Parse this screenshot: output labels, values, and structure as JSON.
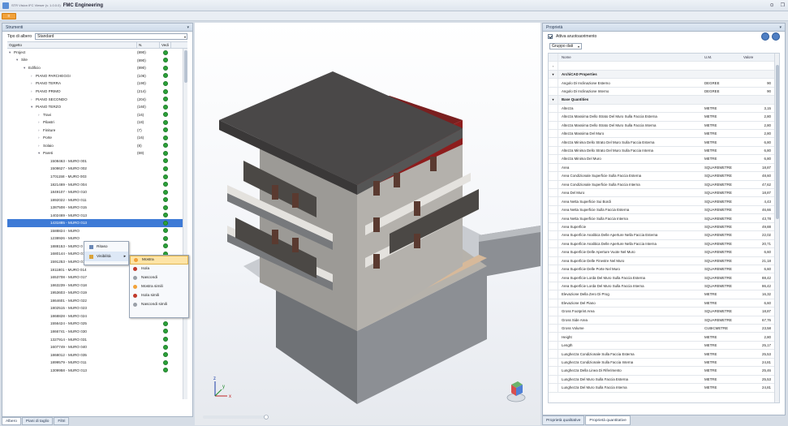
{
  "window": {
    "title_prefix": "STR Vision IFC Viewer (v. 1.0.0.0)",
    "title": "FMC Engineering",
    "controls": [
      "⊙",
      "❐"
    ],
    "menu_label": "≡"
  },
  "left_panel": {
    "header": "Strumenti",
    "tree_type_label": "Tipo di albero",
    "tree_type_value": "Standard",
    "columns": [
      "Oggetto",
      "N.",
      "Vedi"
    ],
    "rows": [
      {
        "indent": 0,
        "arrow": "▾",
        "name": "Project",
        "count": "(890)"
      },
      {
        "indent": 1,
        "arrow": "▾",
        "name": "Site",
        "count": "(890)"
      },
      {
        "indent": 2,
        "arrow": "▾",
        "name": "Edificio",
        "count": "(890)"
      },
      {
        "indent": 3,
        "arrow": "›",
        "name": "PIANO PARCHEGGI",
        "count": "(106)"
      },
      {
        "indent": 3,
        "arrow": "›",
        "name": "PIANO TERRA",
        "count": "(190)"
      },
      {
        "indent": 3,
        "arrow": "›",
        "name": "PIANO PRIMO",
        "count": "(214)"
      },
      {
        "indent": 3,
        "arrow": "›",
        "name": "PIANO SECONDO",
        "count": "(204)"
      },
      {
        "indent": 3,
        "arrow": "▾",
        "name": "PIANO TERZO",
        "count": "(160)"
      },
      {
        "indent": 4,
        "arrow": "›",
        "name": "Travi",
        "count": "(16)"
      },
      {
        "indent": 4,
        "arrow": "›",
        "name": "Pilastri",
        "count": "(18)"
      },
      {
        "indent": 4,
        "arrow": "›",
        "name": "Finiture",
        "count": "(7)"
      },
      {
        "indent": 4,
        "arrow": "›",
        "name": "Porte",
        "count": "(16)"
      },
      {
        "indent": 4,
        "arrow": "›",
        "name": "Solaio",
        "count": "(8)"
      },
      {
        "indent": 4,
        "arrow": "▾",
        "name": "Pareti",
        "count": "(69)"
      },
      {
        "indent": 5,
        "arrow": "",
        "name": "1508463 - MURO 001",
        "count": ""
      },
      {
        "indent": 5,
        "arrow": "",
        "name": "1508627 - MURO 002",
        "count": ""
      },
      {
        "indent": 5,
        "arrow": "",
        "name": "1701158 - MURO 003",
        "count": ""
      },
      {
        "indent": 5,
        "arrow": "",
        "name": "1821469 - MURO 004",
        "count": ""
      },
      {
        "indent": 5,
        "arrow": "",
        "name": "1849107 - MURO 010",
        "count": ""
      },
      {
        "indent": 5,
        "arrow": "",
        "name": "1892022 - MURO 011",
        "count": ""
      },
      {
        "indent": 5,
        "arrow": "",
        "name": "1387508 - MURO 015",
        "count": ""
      },
      {
        "indent": 5,
        "arrow": "",
        "name": "1402469 - MURO 013",
        "count": ""
      },
      {
        "indent": 5,
        "arrow": "",
        "name": "1431885 - MURO 013",
        "count": "",
        "selected": true
      },
      {
        "indent": 5,
        "arrow": "",
        "name": "1588824 - MURO",
        "count": ""
      },
      {
        "indent": 5,
        "arrow": "",
        "name": "1238926 - MURO",
        "count": ""
      },
      {
        "indent": 5,
        "arrow": "",
        "name": "1888153 - MURO 0",
        "count": ""
      },
      {
        "indent": 5,
        "arrow": "",
        "name": "1680144 - MURO 012",
        "count": ""
      },
      {
        "indent": 5,
        "arrow": "",
        "name": "1591253 - MURO 013",
        "count": ""
      },
      {
        "indent": 5,
        "arrow": "",
        "name": "1811801 - MURO 014",
        "count": ""
      },
      {
        "indent": 5,
        "arrow": "",
        "name": "1653708 - MURO 017",
        "count": ""
      },
      {
        "indent": 5,
        "arrow": "",
        "name": "1863239 - MURO 018",
        "count": ""
      },
      {
        "indent": 5,
        "arrow": "",
        "name": "1953603 - MURO 019",
        "count": ""
      },
      {
        "indent": 5,
        "arrow": "",
        "name": "1864601 - MURO 022",
        "count": ""
      },
      {
        "indent": 5,
        "arrow": "",
        "name": "1802515 - MURO 023",
        "count": ""
      },
      {
        "indent": 5,
        "arrow": "",
        "name": "1868828 - MURO 024",
        "count": ""
      },
      {
        "indent": 5,
        "arrow": "",
        "name": "1556424 - MURO 025",
        "count": ""
      },
      {
        "indent": 5,
        "arrow": "",
        "name": "1866741 - MURO 030",
        "count": ""
      },
      {
        "indent": 5,
        "arrow": "",
        "name": "1327914 - MURO 031",
        "count": ""
      },
      {
        "indent": 5,
        "arrow": "",
        "name": "1607749 - MURO 040",
        "count": ""
      },
      {
        "indent": 5,
        "arrow": "",
        "name": "1868012 - MURO 035",
        "count": ""
      },
      {
        "indent": 5,
        "arrow": "",
        "name": "1899579 - MURO 011",
        "count": ""
      },
      {
        "indent": 5,
        "arrow": "",
        "name": "1309958 - MURO 013",
        "count": ""
      }
    ],
    "tabs": [
      "Albero",
      "Piani di taglio",
      "Filtri"
    ]
  },
  "context_menu": {
    "items": [
      "Ritaso",
      "Visibilità"
    ],
    "submenu": [
      {
        "label": "Mostra",
        "color": "#f2a23a"
      },
      {
        "label": "Isola",
        "color": "#c0392b"
      },
      {
        "label": "Nascondi",
        "color": "#9aa0a8"
      },
      {
        "label": "Mostra simili",
        "color": "#f2a23a"
      },
      {
        "label": "Isola simili",
        "color": "#c0392b"
      },
      {
        "label": "Nascondi simili",
        "color": "#9aa0a8"
      }
    ]
  },
  "viewport": {
    "axis_x": "x",
    "axis_y": "y",
    "axis_z": "z"
  },
  "right_panel": {
    "header": "Proprietà",
    "auto_update_label": "Attiva aruotoaorimento",
    "group_value": "Gruppo dati",
    "columns": [
      "Nome",
      "U.M.",
      "Valore"
    ],
    "rows": [
      {
        "type": "blank",
        "name": "",
        "unit": "",
        "value": ""
      },
      {
        "type": "cat",
        "name": "ArchiCAD Properties",
        "unit": "",
        "value": ""
      },
      {
        "type": "row",
        "name": "Angolo Di Inclinazione Esterno",
        "unit": "DEGREE",
        "value": "90"
      },
      {
        "type": "row",
        "name": "Angolo Di Inclinazione Interno",
        "unit": "DEGREE",
        "value": "90"
      },
      {
        "type": "cat",
        "name": "Base Quantities",
        "unit": "",
        "value": ""
      },
      {
        "type": "row",
        "name": "Altezza",
        "unit": "METRE",
        "value": "3,15"
      },
      {
        "type": "row",
        "name": "Altezza Massima Dello Strato Del Muro Sulla Faccia Esterna",
        "unit": "METRE",
        "value": "2,80"
      },
      {
        "type": "row",
        "name": "Altezza Massima Dello Strato Del Muro Sulla Faccia Interna",
        "unit": "METRE",
        "value": "2,80"
      },
      {
        "type": "row",
        "name": "Altezza Massima Del Muro",
        "unit": "METRE",
        "value": "2,80"
      },
      {
        "type": "row",
        "name": "Altezza Minima Dello Strato Del Muro Sulla Faccia Esterna",
        "unit": "METRE",
        "value": "6,80"
      },
      {
        "type": "row",
        "name": "Altezza Minima Dello Strato Del Muro Sulla Faccia Interna",
        "unit": "METRE",
        "value": "6,80"
      },
      {
        "type": "row",
        "name": "Altezza Minima Del Muro",
        "unit": "METRE",
        "value": "6,80"
      },
      {
        "type": "row",
        "name": "Area",
        "unit": "SQUAREMETRE",
        "value": "18,87"
      },
      {
        "type": "row",
        "name": "Area Condizionale Superficie Sulla Faccia Esterna",
        "unit": "SQUAREMETRE",
        "value": "48,60"
      },
      {
        "type": "row",
        "name": "Area Condizionale Superficie Sulla Faccia Interna",
        "unit": "SQUAREMETRE",
        "value": "47,62"
      },
      {
        "type": "row",
        "name": "Area Del Muro",
        "unit": "SQUAREMETRE",
        "value": "18,87"
      },
      {
        "type": "row",
        "name": "Area Netta Superficie Sui Bordi",
        "unit": "SQUAREMETRE",
        "value": "4,43"
      },
      {
        "type": "row",
        "name": "Area Netta Superficie Sulla Faccia Esterna",
        "unit": "SQUAREMETRE",
        "value": "46,66"
      },
      {
        "type": "row",
        "name": "Area Netta Superficie Sulla Faccia Interna",
        "unit": "SQUAREMETRE",
        "value": "43,78"
      },
      {
        "type": "row",
        "name": "Area Superficie",
        "unit": "SQUAREMETRE",
        "value": "49,88"
      },
      {
        "type": "row",
        "name": "Area Superficie Analitica Delle Aperture Nella Faccia Esterna",
        "unit": "SQUAREMETRE",
        "value": "22,02"
      },
      {
        "type": "row",
        "name": "Area Superficie Analitica Delle Aperture Nella Faccia Interna",
        "unit": "SQUAREMETRE",
        "value": "20,71"
      },
      {
        "type": "row",
        "name": "Area Superficie Delle Aperture Vuote Nel Muro",
        "unit": "SQUAREMETRE",
        "value": "6,60"
      },
      {
        "type": "row",
        "name": "Area Superficie Delle Finestre Nel Muro",
        "unit": "SQUAREMETRE",
        "value": "21,18"
      },
      {
        "type": "row",
        "name": "Area Superficie Delle Porte Nel Muro",
        "unit": "SQUAREMETRE",
        "value": "6,60"
      },
      {
        "type": "row",
        "name": "Area Superficie Lorda Del Muro Sulla Faccia Esterna",
        "unit": "SQUAREMETRE",
        "value": "88,42"
      },
      {
        "type": "row",
        "name": "Area Superficie Lorda Del Muro Sulla Faccia Interna",
        "unit": "SQUAREMETRE",
        "value": "86,42"
      },
      {
        "type": "row",
        "name": "Elevazione Della Zero Di Prog",
        "unit": "METRE",
        "value": "16,32"
      },
      {
        "type": "row",
        "name": "Elevazione Del Piano",
        "unit": "METRE",
        "value": "6,60"
      },
      {
        "type": "row",
        "name": "Gross Footprint Area",
        "unit": "SQUAREMETRE",
        "value": "18,87"
      },
      {
        "type": "row",
        "name": "Gross Side Area",
        "unit": "SQUAREMETRE",
        "value": "67,76"
      },
      {
        "type": "row",
        "name": "Gross Volume",
        "unit": "CUBICMETRE",
        "value": "23,58"
      },
      {
        "type": "row",
        "name": "Height",
        "unit": "METRE",
        "value": "2,80"
      },
      {
        "type": "row",
        "name": "Length",
        "unit": "METRE",
        "value": "25,17"
      },
      {
        "type": "row",
        "name": "Lunghezza Condizionale Sulla Faccia Esterna",
        "unit": "METRE",
        "value": "25,53"
      },
      {
        "type": "row",
        "name": "Lunghezza Condizionale Sulla Faccia Interna",
        "unit": "METRE",
        "value": "24,81"
      },
      {
        "type": "row",
        "name": "Lunghezza Della Linea Di Riferimento",
        "unit": "METRE",
        "value": "25,46"
      },
      {
        "type": "row",
        "name": "Lunghezza Del Muro Sulla Faccia Esterna",
        "unit": "METRE",
        "value": "25,53"
      },
      {
        "type": "row",
        "name": "Lunghezza Del Muro Sulla Faccia Interna",
        "unit": "METRE",
        "value": "24,81"
      }
    ],
    "tabs": [
      "Proprietà qualitative",
      "Proprietà quantitative"
    ]
  }
}
